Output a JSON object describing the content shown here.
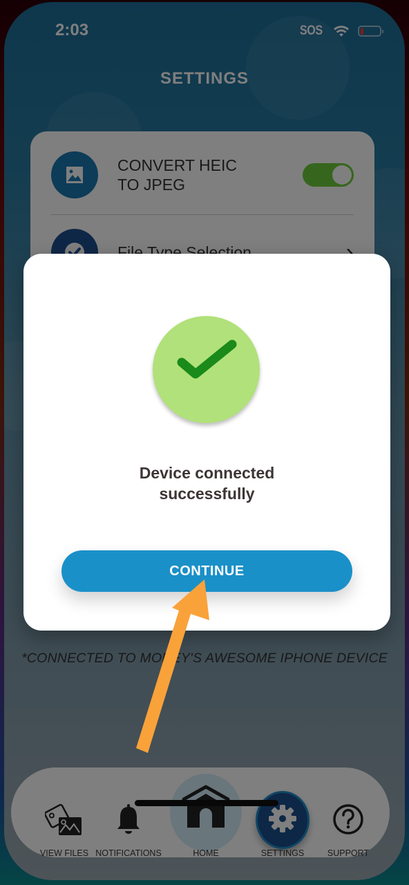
{
  "status_bar": {
    "time": "2:03",
    "carrier": "SOS",
    "wifi_icon": "wifi-icon",
    "battery_icon": "battery-low-icon",
    "battery_level_percent": 10
  },
  "header": {
    "title": "SETTINGS"
  },
  "settings": {
    "items": [
      {
        "label": "CONVERT HEIC\nTO JPEG",
        "label_line1": "CONVERT HEIC",
        "label_line2": "TO JPEG",
        "icon": "image-icon",
        "control": "toggle",
        "toggle_on": true,
        "icon_color": "#1a78b0",
        "toggle_color": "#6ccc3a"
      },
      {
        "label": "File Type Selection",
        "icon": "check-circle-icon",
        "control": "chevron",
        "icon_color": "#1f4f8f"
      }
    ]
  },
  "footnote": "*CONNECTED TO MONEY'S AWESOME IPHONE DEVICE",
  "modal": {
    "icon": "checkmark-icon",
    "message_line1": "Device connected",
    "message_line2": "successfully",
    "continue_label": "CONTINUE",
    "accent_color": "#1a90c8",
    "check_bg_color": "#b1e17a",
    "check_color": "#1a8a1a"
  },
  "nav": {
    "items": [
      {
        "label": "VIEW FILES",
        "icon": "photos-icon"
      },
      {
        "label": "NOTIFICATIONS",
        "icon": "bell-icon"
      },
      {
        "label": "HOME",
        "icon": "home-icon"
      },
      {
        "label": "SETTINGS",
        "icon": "gear-icon",
        "active": true
      },
      {
        "label": "SUPPORT",
        "icon": "help-circle-icon"
      }
    ]
  },
  "annotation": {
    "type": "arrow",
    "color": "#f9a23a",
    "points_to": "CONTINUE"
  }
}
